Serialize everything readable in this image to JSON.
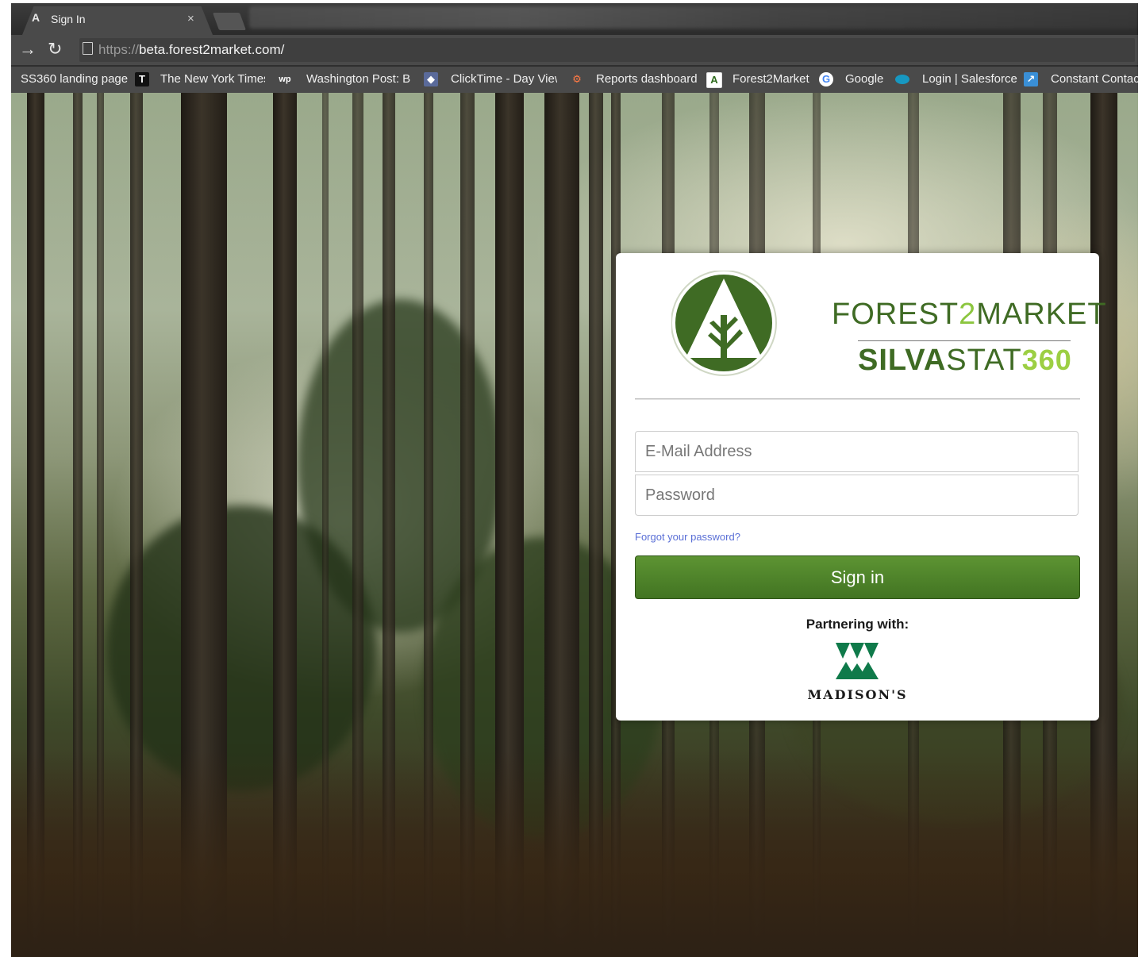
{
  "browser": {
    "tab_title": "Sign In",
    "tab_close": "×",
    "url_scheme": "https://",
    "url_host_path": "beta.forest2market.com/",
    "bookmarks": [
      {
        "label": "SS360 landing page"
      },
      {
        "label": "The New York Times"
      },
      {
        "label": "Washington Post: Br"
      },
      {
        "label": "ClickTime - Day View"
      },
      {
        "label": "Reports dashboard"
      },
      {
        "label": "Forest2Market"
      },
      {
        "label": "Google"
      },
      {
        "label": "Login | Salesforce"
      },
      {
        "label": "Constant Contact"
      }
    ]
  },
  "login": {
    "brand_line1_a": "FOREST",
    "brand_line1_b": "2",
    "brand_line1_c": "MARKET",
    "brand_line2_a": "SILVA",
    "brand_line2_b": "STAT",
    "brand_line2_c": "360",
    "email_placeholder": "E-Mail Address",
    "password_placeholder": "Password",
    "forgot_link": "Forgot your password?",
    "signin_label": "Sign in",
    "partner_label": "Partnering with:",
    "partner_name": "MADISON'S"
  },
  "colors": {
    "brand_green": "#3f6b24",
    "brand_light_green": "#8cc63f",
    "button_green": "#4f8429",
    "link_blue": "#5a6fd6",
    "madison_green": "#0f7a4a"
  },
  "icons": {
    "back": "arrow-right-icon",
    "reload": "reload-icon",
    "page": "page-icon",
    "logo": "forest2market-tree-logo-icon",
    "partner": "madisons-logo-icon"
  }
}
